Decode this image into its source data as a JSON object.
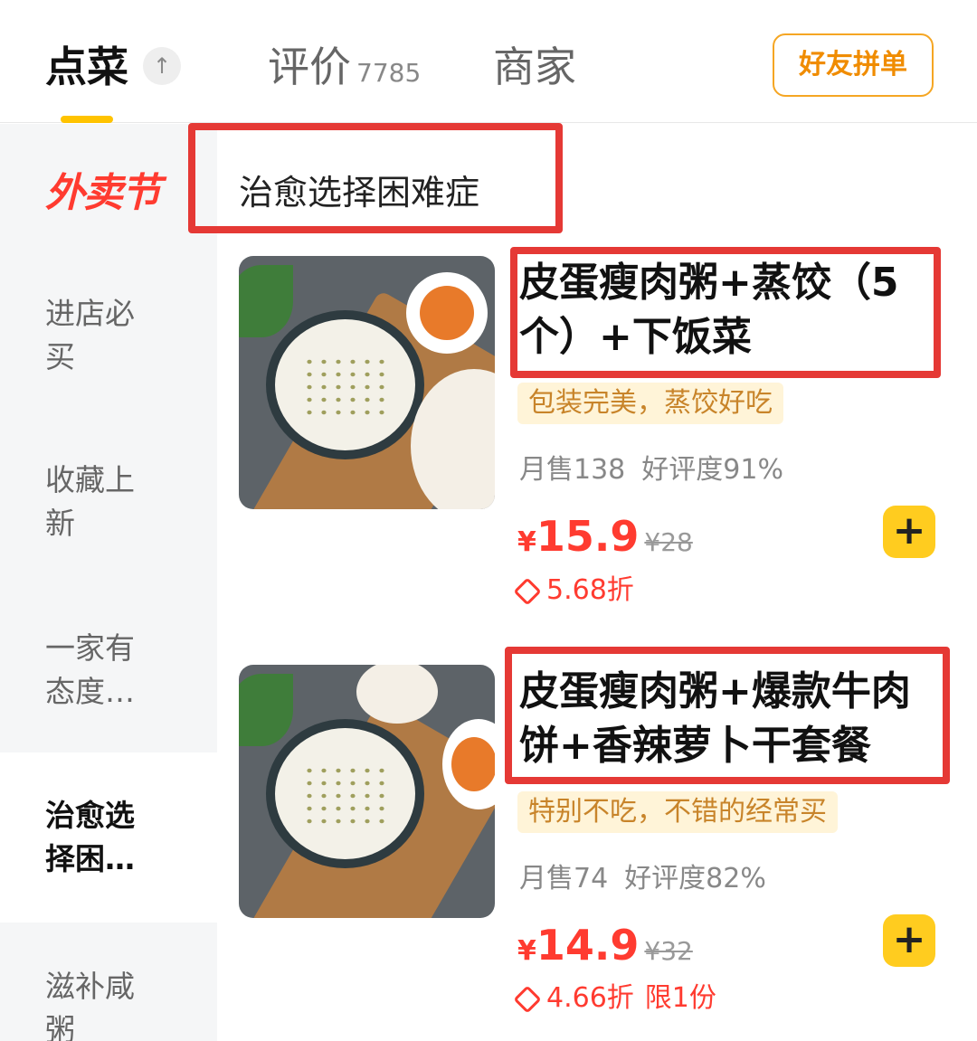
{
  "tabs": {
    "order": "点菜",
    "pin_icon": "↑",
    "reviews": "评价",
    "reviews_count": "7785",
    "merchant": "商家"
  },
  "group_order_button": "好友拼单",
  "sidebar": {
    "logo": "外卖节",
    "items": [
      {
        "label": "进店必买"
      },
      {
        "label": "收藏上新"
      },
      {
        "label": "一家有态度…"
      },
      {
        "label": "治愈选择困…",
        "active": true
      },
      {
        "label": "滋补咸粥"
      }
    ]
  },
  "section_title": "治愈选择困难症",
  "products": [
    {
      "title": "皮蛋瘦肉粥+蒸饺（5个）+下饭菜",
      "tagline": "包装完美，蒸饺好吃",
      "monthly_sales": "月售138",
      "rating": "好评度91%",
      "currency": "¥",
      "price": "15.9",
      "original_price": "¥28",
      "discount": "5.68折",
      "limit": "",
      "add_icon": "+"
    },
    {
      "title": "皮蛋瘦肉粥+爆款牛肉饼+香辣萝卜干套餐",
      "tagline": "特别不吃，不错的经常买",
      "monthly_sales": "月售74",
      "rating": "好评度82%",
      "currency": "¥",
      "price": "14.9",
      "original_price": "¥32",
      "discount": "4.66折",
      "limit": "限1份",
      "add_icon": "+"
    }
  ],
  "colors": {
    "accent_yellow": "#ffc300",
    "price_red": "#ff3b30",
    "highlight_box": "#e53935",
    "group_button": "#f5a623"
  }
}
